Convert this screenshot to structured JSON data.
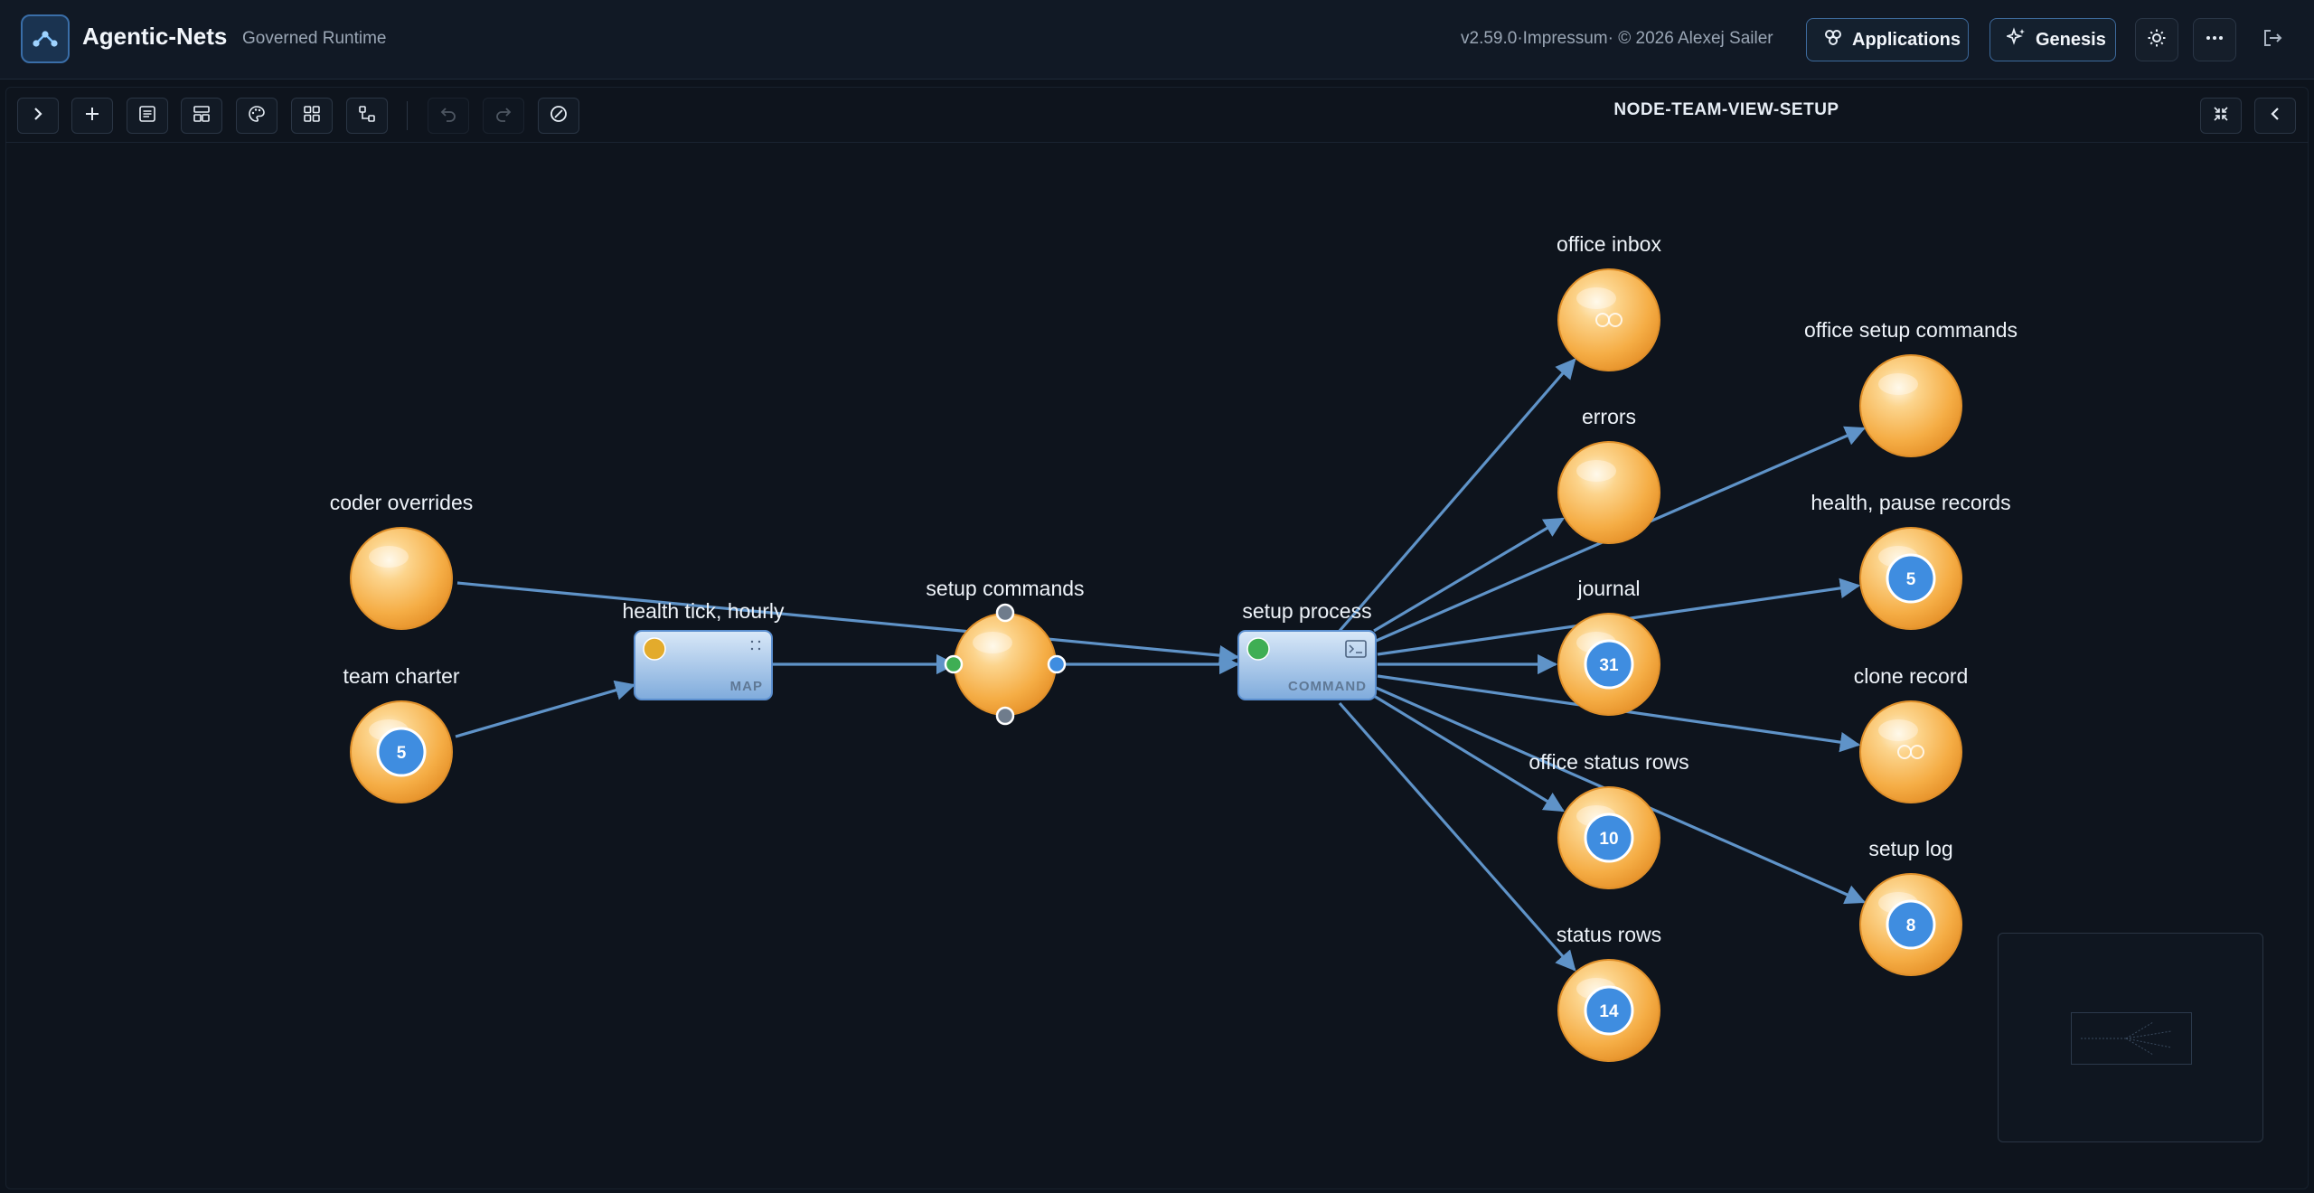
{
  "header": {
    "app_title": "Agentic-Nets",
    "app_subtitle": "Governed Runtime",
    "version_text": "v2.59.0·Impressum· © 2026 Alexej Sailer",
    "applications_label": "Applications",
    "genesis_label": "Genesis",
    "icons": [
      "net-logo-icon",
      "applications-icon",
      "sparkle-icon",
      "sun-icon",
      "more-icon",
      "logout-icon"
    ]
  },
  "toolbar": {
    "view_title": "NODE-TEAM-VIEW-SETUP",
    "buttons": [
      "expand-panel",
      "add",
      "list",
      "layout",
      "palette",
      "grid",
      "connect",
      "undo",
      "redo",
      "validate"
    ],
    "disabled": [
      "undo",
      "redo"
    ]
  },
  "colors": {
    "place_fill": "#f5ad45",
    "place_rim": "#e0902a",
    "token_badge": "#3f8de0",
    "transition_fill": "#8fb8e6",
    "edge": "#5f93c8",
    "port_green": "#3fae54",
    "port_blue": "#3f8de0",
    "port_grey": "#6f7c8c",
    "status_yellow": "#e3ab2c",
    "status_green": "#3fae54"
  },
  "transitions": [
    {
      "id": "health_tick",
      "label": "health tick, hourly",
      "kind": "MAP",
      "status": "yellow"
    },
    {
      "id": "setup_process",
      "label": "setup process",
      "kind": "COMMAND",
      "status": "green"
    }
  ],
  "places": [
    {
      "id": "coder_overrides",
      "label": "coder overrides",
      "tokens": ""
    },
    {
      "id": "team_charter",
      "label": "team charter",
      "tokens": "5"
    },
    {
      "id": "setup_commands",
      "label": "setup commands",
      "tokens": ""
    },
    {
      "id": "office_inbox",
      "label": "office inbox",
      "tokens": "",
      "linked": true
    },
    {
      "id": "errors",
      "label": "errors",
      "tokens": ""
    },
    {
      "id": "journal",
      "label": "journal",
      "tokens": "31"
    },
    {
      "id": "office_status_rows",
      "label": "office status rows",
      "tokens": "10"
    },
    {
      "id": "status_rows",
      "label": "status rows",
      "tokens": "14"
    },
    {
      "id": "office_setup_commands",
      "label": "office setup commands",
      "tokens": ""
    },
    {
      "id": "health_pause_records",
      "label": "health, pause records",
      "tokens": "5"
    },
    {
      "id": "clone_record",
      "label": "clone record",
      "tokens": "",
      "linked": true
    },
    {
      "id": "setup_log",
      "label": "setup log",
      "tokens": "8"
    }
  ]
}
